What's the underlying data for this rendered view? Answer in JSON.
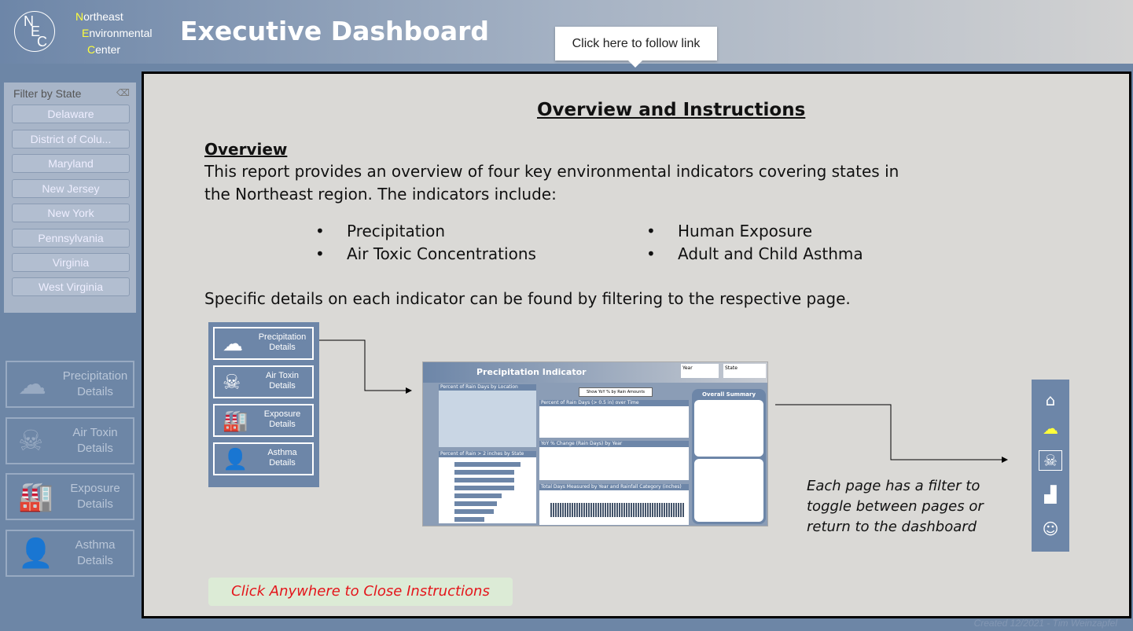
{
  "header": {
    "logo_letters": [
      "N",
      "E",
      "C"
    ],
    "org_lines": [
      {
        "initial": "N",
        "rest": "ortheast"
      },
      {
        "initial": "E",
        "rest": "nvironmental"
      },
      {
        "initial": "C",
        "rest": "enter"
      }
    ],
    "title": "Executive Dashboard"
  },
  "tooltip": "Click here to follow link",
  "filter": {
    "label": "Filter by State",
    "states": [
      "Delaware",
      "District of Colu...",
      "Maryland",
      "New Jersey",
      "New York",
      "Pennsylvania",
      "Virginia",
      "West Virginia"
    ]
  },
  "nav": [
    {
      "icon": "rain-cloud-icon",
      "l1": "Precipitation",
      "l2": "Details"
    },
    {
      "icon": "skull-icon",
      "l1": "Air Toxin",
      "l2": "Details"
    },
    {
      "icon": "factory-icon",
      "l1": "Exposure",
      "l2": "Details"
    },
    {
      "icon": "person-icon",
      "l1": "Asthma",
      "l2": "Details"
    }
  ],
  "footer": "Created 12/2021 - Tim Weinzapfel",
  "overlay": {
    "title": "Overview and Instructions",
    "overview_heading": "Overview",
    "para1_l1": "This report provides an overview of four key environmental indicators covering states in",
    "para1_l2": "the Northeast region.  The indicators include:",
    "bullets_left": [
      "Precipitation",
      "Air Toxic Concentrations"
    ],
    "bullets_right": [
      "Human Exposure",
      "Adult and Child Asthma"
    ],
    "para2": "Specific details on each indicator can be found by filtering to the respective page.",
    "thumbnail": {
      "title": "Precipitation Indicator",
      "panels": [
        "Percent of Rain Days by Location",
        "Percent of Rain > 2 inches by State",
        "Percent of Rain Days (> 0.5 in) over Time",
        "YoY % Change (Rain Days) by Year",
        "Total Days Measured by Year and Rainfall Category (inches)",
        "Overall Summary"
      ],
      "button": "Show YoY % by Rain Amounts",
      "filters": [
        "Year",
        "State"
      ]
    },
    "note": [
      "Each page has a filter to",
      "toggle between pages or",
      "return to the dashboard"
    ],
    "close": "Click Anywhere to Close Instructions"
  },
  "colors": {
    "brand": "#6d86a8",
    "close_text": "#e4151b",
    "highlight": "#ffff3a"
  }
}
